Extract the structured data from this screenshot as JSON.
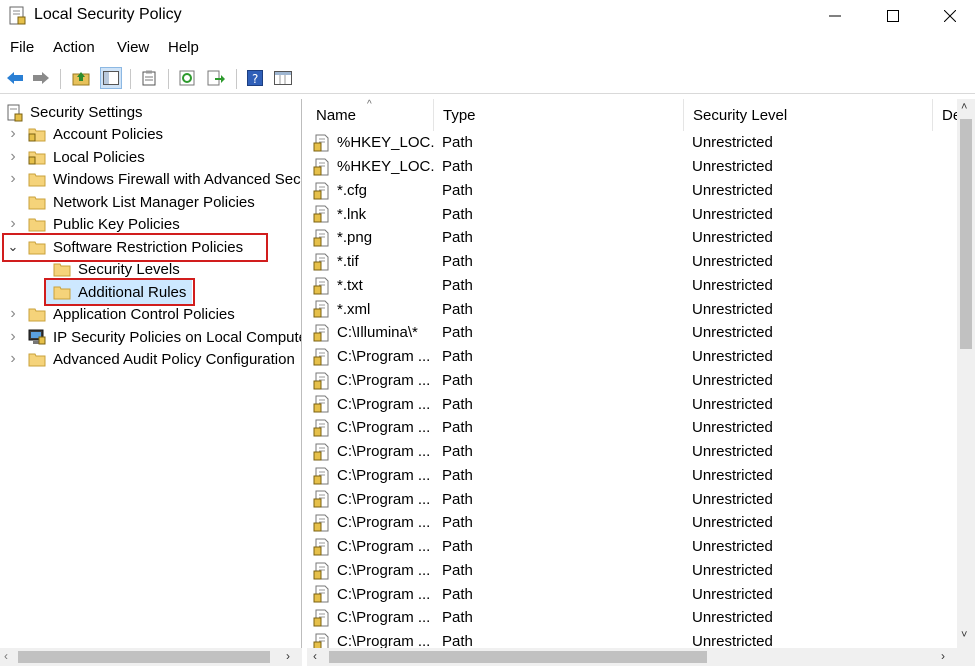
{
  "window": {
    "title": "Local Security Policy",
    "minimize_glyph": "—",
    "maximize_glyph": "☐",
    "close_glyph": "✕"
  },
  "menu": [
    "File",
    "Action",
    "View",
    "Help"
  ],
  "toolbar": {
    "icons": [
      "back-arrow-icon",
      "forward-arrow-icon",
      "up-folder-icon",
      "show-hide-tree-icon",
      "properties-icon",
      "refresh-icon",
      "export-list-icon",
      "help-icon",
      "view-columns-icon"
    ]
  },
  "tree": {
    "root": "Security Settings",
    "items": [
      {
        "label": "Account Policies",
        "expander": "›"
      },
      {
        "label": "Local Policies",
        "expander": "›"
      },
      {
        "label": "Windows Firewall with Advanced Security",
        "expander": "›"
      },
      {
        "label": "Network List Manager Policies",
        "expander": ""
      },
      {
        "label": "Public Key Policies",
        "expander": "›"
      },
      {
        "label": "Software Restriction Policies",
        "expander": "⌄"
      },
      {
        "label": "Security Levels",
        "expander": ""
      },
      {
        "label": "Additional Rules",
        "expander": ""
      },
      {
        "label": "Application Control Policies",
        "expander": "›"
      },
      {
        "label": "IP Security Policies on Local Computer",
        "expander": "›"
      },
      {
        "label": "Advanced Audit Policy Configuration",
        "expander": "›"
      }
    ]
  },
  "list": {
    "columns": [
      "Name",
      "Type",
      "Security Level",
      "De"
    ],
    "rows": [
      {
        "name": "%HKEY_LOC...",
        "type": "Path",
        "level": "Unrestricted"
      },
      {
        "name": "%HKEY_LOC...",
        "type": "Path",
        "level": "Unrestricted"
      },
      {
        "name": "*.cfg",
        "type": "Path",
        "level": "Unrestricted"
      },
      {
        "name": "*.lnk",
        "type": "Path",
        "level": "Unrestricted"
      },
      {
        "name": "*.png",
        "type": "Path",
        "level": "Unrestricted"
      },
      {
        "name": "*.tif",
        "type": "Path",
        "level": "Unrestricted"
      },
      {
        "name": "*.txt",
        "type": "Path",
        "level": "Unrestricted"
      },
      {
        "name": "*.xml",
        "type": "Path",
        "level": "Unrestricted"
      },
      {
        "name": "C:\\Illumina\\*",
        "type": "Path",
        "level": "Unrestricted"
      },
      {
        "name": "C:\\Program ...",
        "type": "Path",
        "level": "Unrestricted"
      },
      {
        "name": "C:\\Program ...",
        "type": "Path",
        "level": "Unrestricted"
      },
      {
        "name": "C:\\Program ...",
        "type": "Path",
        "level": "Unrestricted"
      },
      {
        "name": "C:\\Program ...",
        "type": "Path",
        "level": "Unrestricted"
      },
      {
        "name": "C:\\Program ...",
        "type": "Path",
        "level": "Unrestricted"
      },
      {
        "name": "C:\\Program ...",
        "type": "Path",
        "level": "Unrestricted"
      },
      {
        "name": "C:\\Program ...",
        "type": "Path",
        "level": "Unrestricted"
      },
      {
        "name": "C:\\Program ...",
        "type": "Path",
        "level": "Unrestricted"
      },
      {
        "name": "C:\\Program ...",
        "type": "Path",
        "level": "Unrestricted"
      },
      {
        "name": "C:\\Program ...",
        "type": "Path",
        "level": "Unrestricted"
      },
      {
        "name": "C:\\Program ...",
        "type": "Path",
        "level": "Unrestricted"
      },
      {
        "name": "C:\\Program ...",
        "type": "Path",
        "level": "Unrestricted"
      },
      {
        "name": "C:\\Program ...",
        "type": "Path",
        "level": "Unrestricted"
      }
    ]
  },
  "colors": {
    "highlight_border": "#d11d1d",
    "folder": "#f5d37a"
  }
}
